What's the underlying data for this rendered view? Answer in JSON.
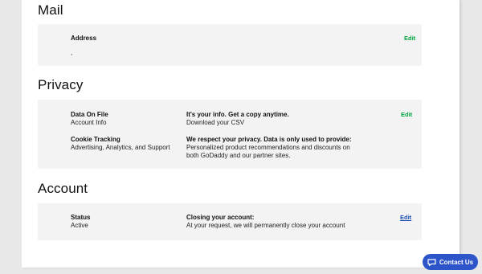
{
  "mail": {
    "title": "Mail",
    "address_label": "Address",
    "address_value": ",",
    "edit_label": "Edit"
  },
  "privacy": {
    "title": "Privacy",
    "data_on_file_label": "Data On File",
    "data_on_file_value": "Account Info",
    "info_heading": "It's your info. Get a copy anytime.",
    "info_sub": "Download your CSV",
    "cookie_label": "Cookie Tracking",
    "cookie_value": "Advertising, Analytics, and Support",
    "respect_heading": "We respect your privacy. Data is only used to provide:",
    "respect_line1": "Personalized product recommendations and discounts on",
    "respect_line2": "both GoDaddy and our partner sites.",
    "edit_label": "Edit"
  },
  "account": {
    "title": "Account",
    "status_label": "Status",
    "status_value": "Active",
    "closing_heading": "Closing your account:",
    "closing_sub": "At your request, we will permanently close your account",
    "edit_label": "Edit"
  },
  "contact": {
    "label": "Contact Us",
    "icon": "chat-icon"
  },
  "colors": {
    "edit_green": "#00a63f",
    "edit_blue": "#1e4fb3",
    "contact_bg": "#2d55c9"
  }
}
